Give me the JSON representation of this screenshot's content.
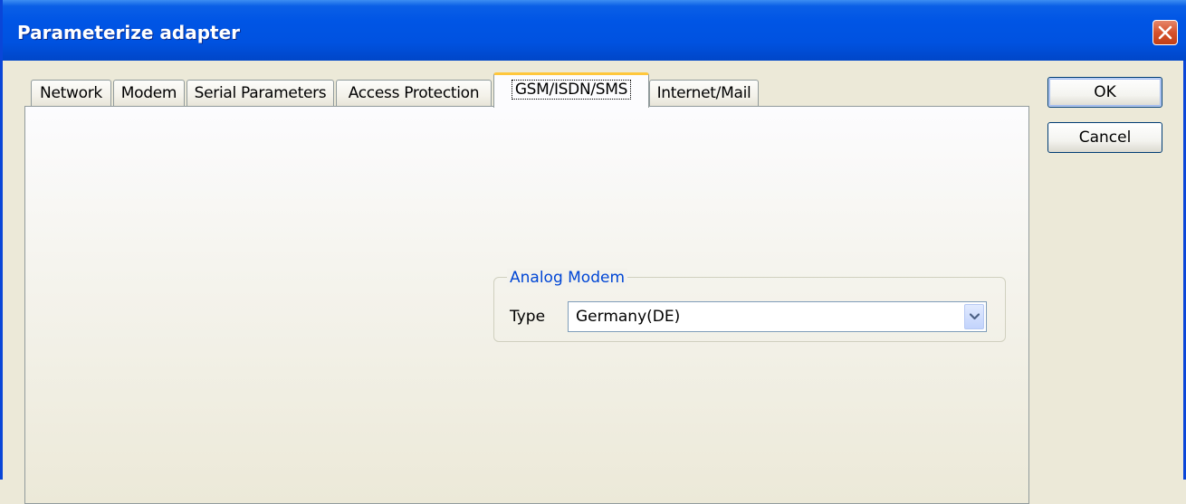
{
  "window": {
    "title": "Parameterize adapter"
  },
  "tabs": [
    {
      "label": "Network",
      "active": false
    },
    {
      "label": "Modem",
      "active": false
    },
    {
      "label": "Serial Parameters",
      "active": false
    },
    {
      "label": "Access Protection",
      "active": false
    },
    {
      "label": "GSM/ISDN/SMS",
      "active": true
    },
    {
      "label": "Internet/Mail",
      "active": false
    }
  ],
  "analog_modem": {
    "group_label": "Analog Modem",
    "type_label": "Type",
    "type_value": "Germany(DE)"
  },
  "buttons": {
    "ok": "OK",
    "cancel": "Cancel"
  },
  "icons": {
    "close": "close-icon",
    "dropdown": "chevron-down-icon"
  },
  "colors": {
    "titlebar": "#0055e5",
    "active_tab_highlight": "#ffc73c",
    "group_label": "#0046d5",
    "close_button": "#d6522c"
  }
}
